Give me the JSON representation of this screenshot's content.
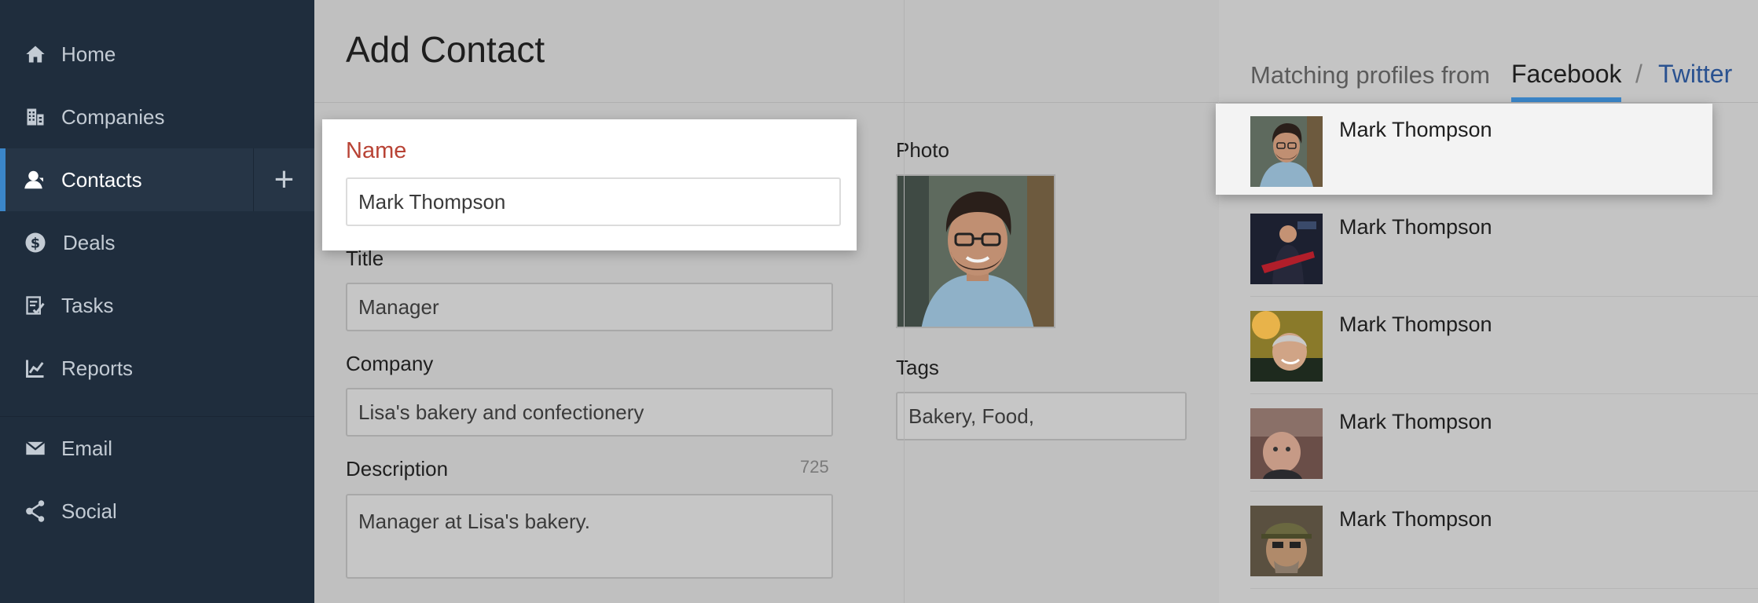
{
  "sidebar": {
    "items": [
      {
        "label": "Home",
        "icon": "home-icon"
      },
      {
        "label": "Companies",
        "icon": "companies-icon"
      },
      {
        "label": "Contacts",
        "icon": "contacts-icon",
        "active": true
      },
      {
        "label": "Deals",
        "icon": "deals-icon"
      },
      {
        "label": "Tasks",
        "icon": "tasks-icon"
      },
      {
        "label": "Reports",
        "icon": "reports-icon"
      },
      {
        "label": "Email",
        "icon": "email-icon"
      },
      {
        "label": "Social",
        "icon": "social-icon"
      }
    ],
    "add_label": "+"
  },
  "form": {
    "title": "Add Contact",
    "name": {
      "label": "Name",
      "value": "Mark Thompson"
    },
    "job_title": {
      "label": "Title",
      "value": "Manager"
    },
    "company": {
      "label": "Company",
      "value": "Lisa's bakery and confectionery"
    },
    "description": {
      "label": "Description",
      "value": "Manager at Lisa's bakery.",
      "counter": "725"
    },
    "photo": {
      "label": "Photo"
    },
    "tags": {
      "label": "Tags",
      "value": "Bakery, Food,"
    }
  },
  "matches": {
    "heading": "Matching profiles from",
    "tabs": [
      "Facebook",
      "Twitter"
    ],
    "separator": "/",
    "profiles": [
      {
        "name": "Mark Thompson"
      },
      {
        "name": "Mark Thompson"
      },
      {
        "name": "Mark Thompson"
      },
      {
        "name": "Mark Thompson"
      },
      {
        "name": "Mark Thompson"
      }
    ]
  },
  "colors": {
    "sidebar_bg": "#1f2d3d",
    "accent": "#3b86c9",
    "name_label": "#b84335",
    "twitter_link": "#2a5290"
  }
}
